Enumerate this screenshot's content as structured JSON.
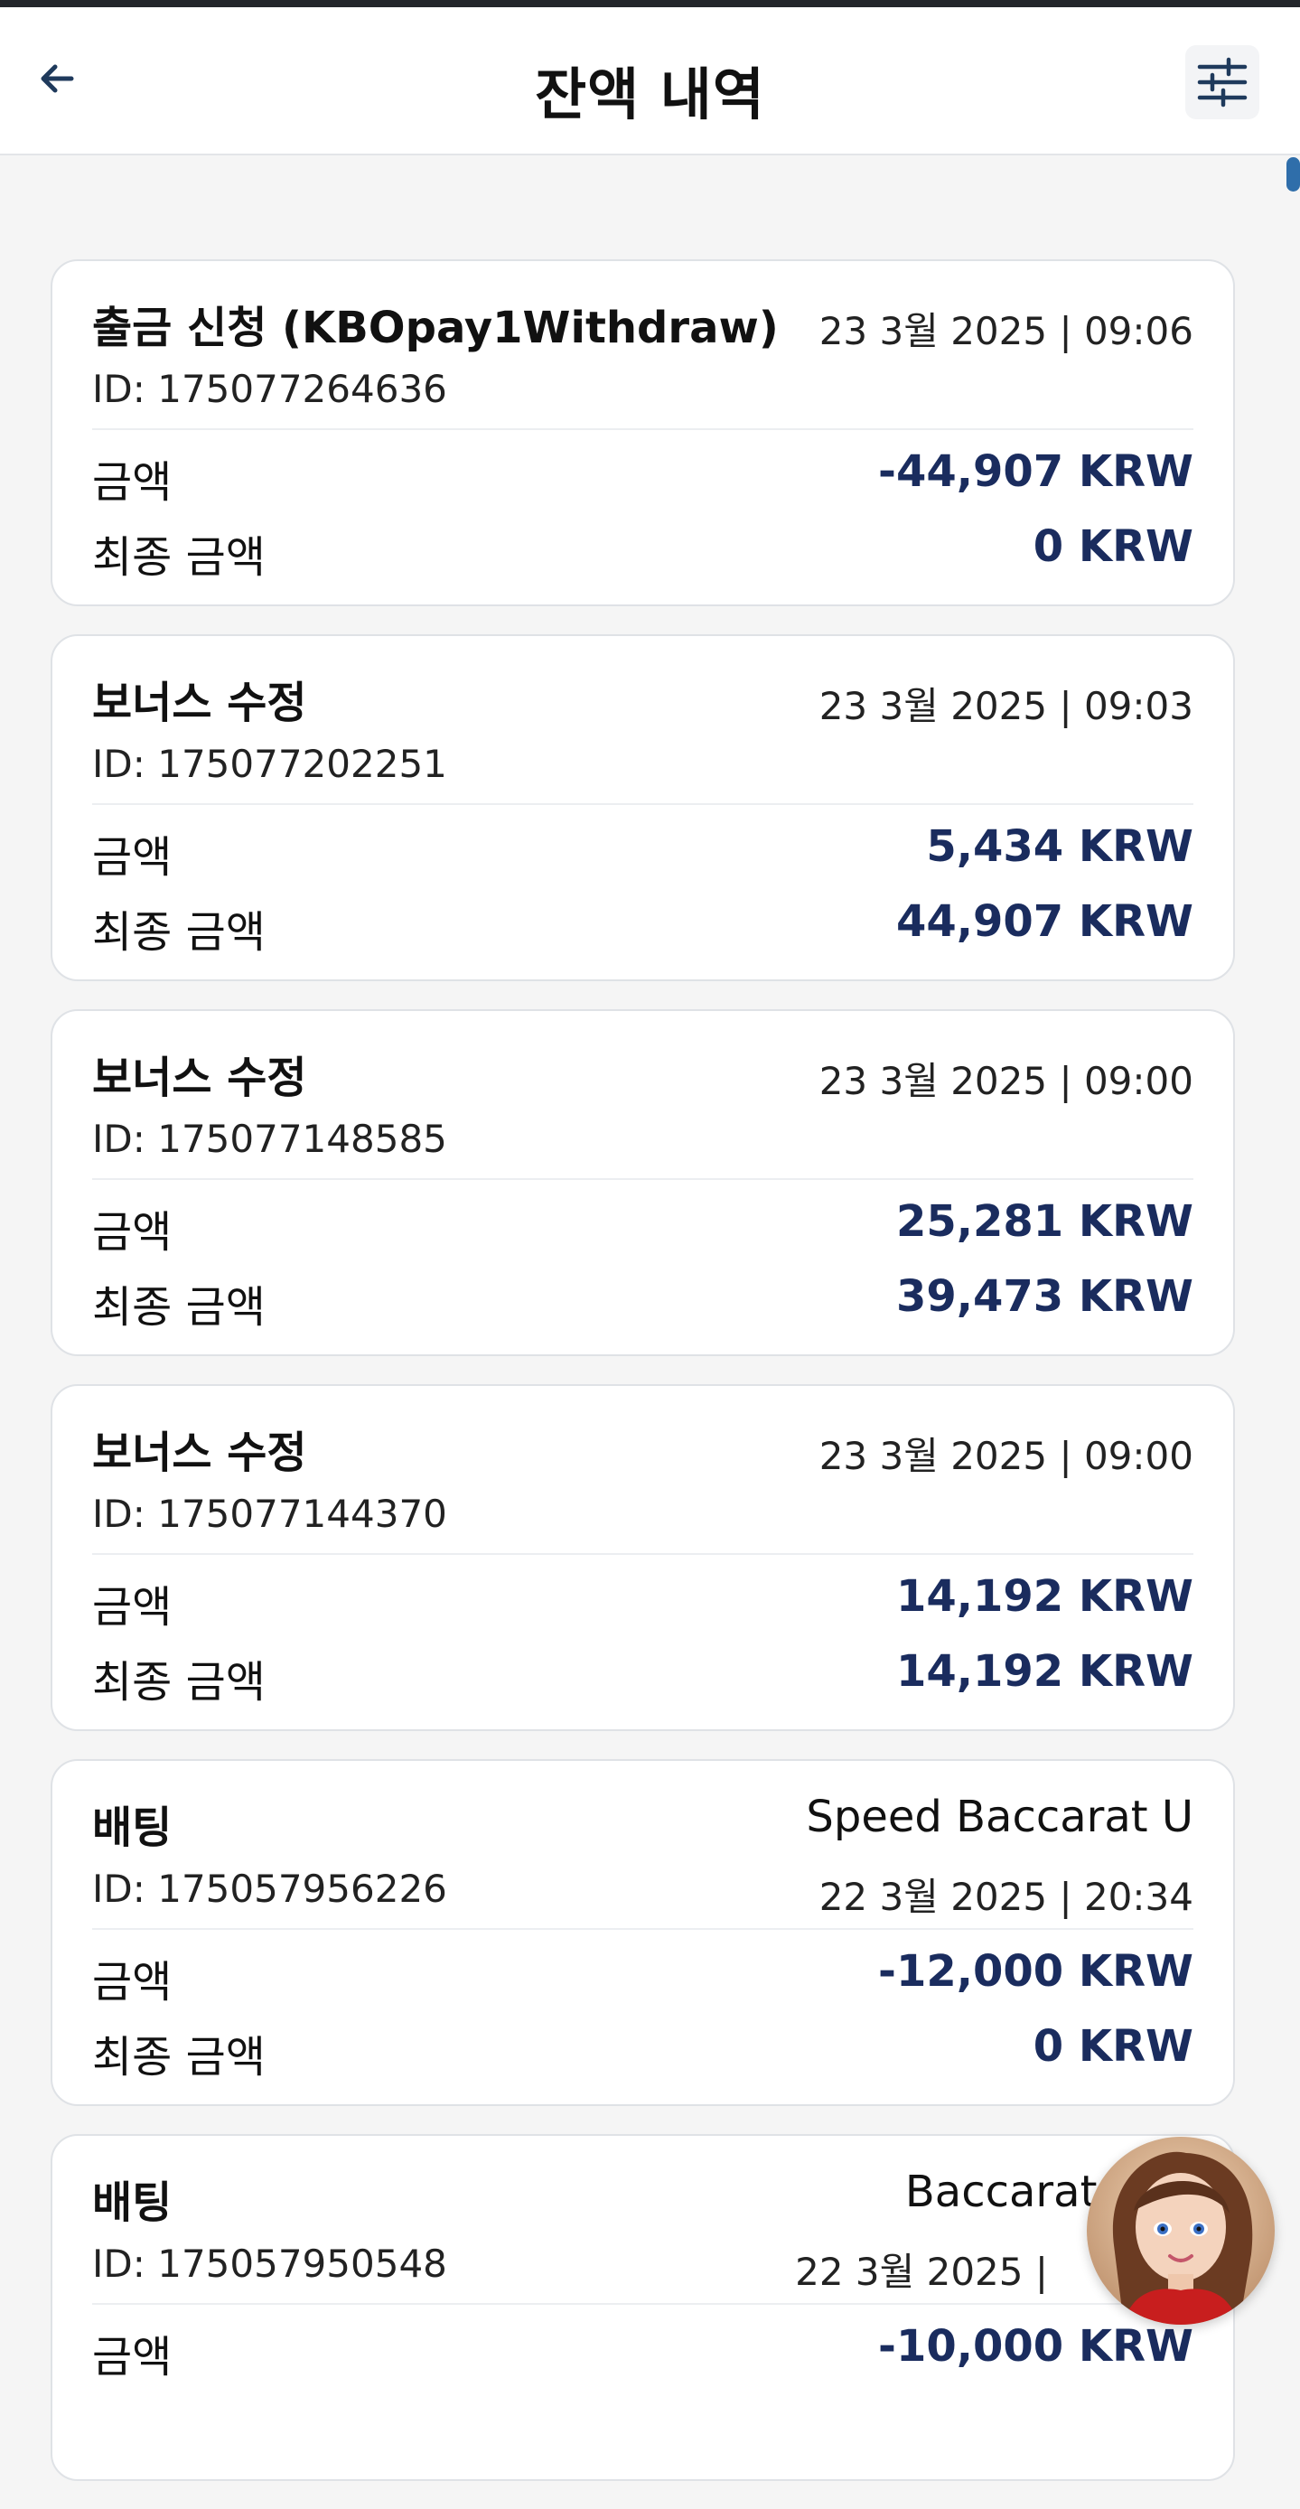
{
  "header": {
    "title": "잔액 내역",
    "back_icon": "arrow-left-icon",
    "filter_icon": "sliders-icon"
  },
  "colors": {
    "amount": "#1a2c5e",
    "header_bg": "#ffffff",
    "page_bg": "#f5f5f5"
  },
  "transactions": [
    {
      "title": "출금 신청 (KBOpay1Withdraw)",
      "datetime": "23 3월 2025 | 09:06",
      "id": "ID: 175077264636",
      "amount_label": "금액",
      "amount": "-44,907 KRW",
      "final_label": "최종 금액",
      "final_amount": "0 KRW"
    },
    {
      "title": "보너스 수정",
      "datetime": "23 3월 2025 | 09:03",
      "id": "ID: 175077202251",
      "amount_label": "금액",
      "amount": "5,434 KRW",
      "final_label": "최종 금액",
      "final_amount": "44,907 KRW"
    },
    {
      "title": "보너스 수정",
      "datetime": "23 3월 2025 | 09:00",
      "id": "ID: 175077148585",
      "amount_label": "금액",
      "amount": "25,281 KRW",
      "final_label": "최종 금액",
      "final_amount": "39,473 KRW"
    },
    {
      "title": "보너스 수정",
      "datetime": "23 3월 2025 | 09:00",
      "id": "ID: 175077144370",
      "amount_label": "금액",
      "amount": "14,192 KRW",
      "final_label": "최종 금액",
      "final_amount": "14,192 KRW"
    },
    {
      "title": "배팅",
      "game": "Speed Baccarat U",
      "datetime": "22 3월 2025 | 20:34",
      "id": "ID: 175057956226",
      "amount_label": "금액",
      "amount": "-12,000 KRW",
      "final_label": "최종 금액",
      "final_amount": "0 KRW"
    },
    {
      "title": "배팅",
      "game": "Baccarat Squ",
      "datetime": "22 3월 2025 |",
      "id": "ID: 175057950548",
      "amount_label": "금액",
      "amount": "-10,000 KRW"
    }
  ],
  "assistant_avatar": "assistant-avatar"
}
